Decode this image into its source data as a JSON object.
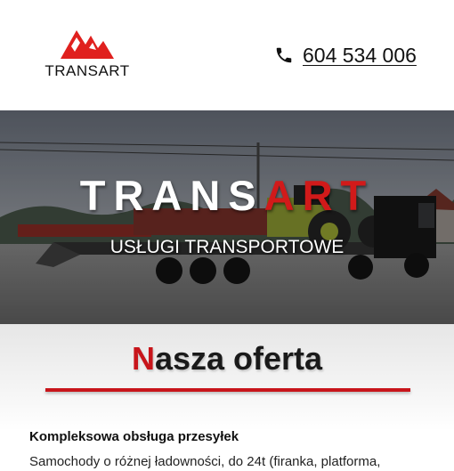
{
  "header": {
    "logo_text": "TRANSART",
    "phone_number": "604 534 006"
  },
  "hero": {
    "title_prefix": "TRANS",
    "title_highlight": "ART",
    "subtitle": "USŁUGI TRANSPORTOWE"
  },
  "offer": {
    "title_first": "N",
    "title_rest": "asza oferta",
    "item_title": "Kompleksowa obsługa przesyłek",
    "item_desc": "Samochody o różnej ładowności, do 24t (firanka, platforma,"
  },
  "colors": {
    "brand_red": "#c8151b",
    "text_dark": "#111111",
    "hero_text": "#ffffff"
  },
  "icons": {
    "logo": "transart-logo-icon",
    "phone": "phone-icon"
  }
}
